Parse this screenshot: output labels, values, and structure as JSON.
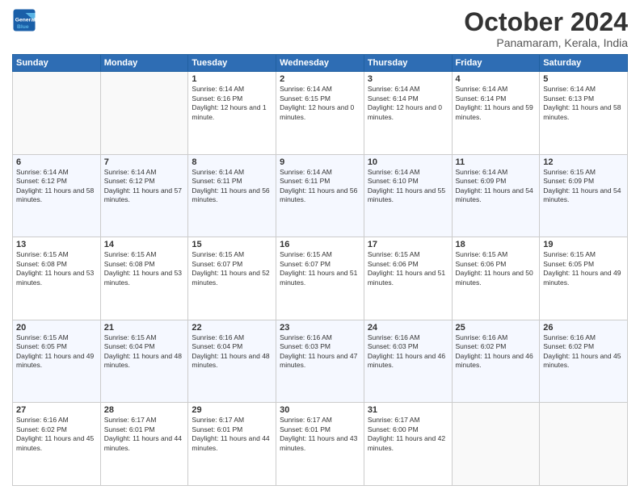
{
  "header": {
    "logo_line1": "General",
    "logo_line2": "Blue",
    "month_title": "October 2024",
    "location": "Panamaram, Kerala, India"
  },
  "days_of_week": [
    "Sunday",
    "Monday",
    "Tuesday",
    "Wednesday",
    "Thursday",
    "Friday",
    "Saturday"
  ],
  "weeks": [
    {
      "days": [
        {
          "num": "",
          "empty": true
        },
        {
          "num": "",
          "empty": true
        },
        {
          "num": "1",
          "sunrise": "6:14 AM",
          "sunset": "6:16 PM",
          "daylight": "12 hours and 1 minute."
        },
        {
          "num": "2",
          "sunrise": "6:14 AM",
          "sunset": "6:15 PM",
          "daylight": "12 hours and 0 minutes."
        },
        {
          "num": "3",
          "sunrise": "6:14 AM",
          "sunset": "6:14 PM",
          "daylight": "12 hours and 0 minutes."
        },
        {
          "num": "4",
          "sunrise": "6:14 AM",
          "sunset": "6:14 PM",
          "daylight": "11 hours and 59 minutes."
        },
        {
          "num": "5",
          "sunrise": "6:14 AM",
          "sunset": "6:13 PM",
          "daylight": "11 hours and 58 minutes."
        }
      ]
    },
    {
      "days": [
        {
          "num": "6",
          "sunrise": "6:14 AM",
          "sunset": "6:12 PM",
          "daylight": "11 hours and 58 minutes."
        },
        {
          "num": "7",
          "sunrise": "6:14 AM",
          "sunset": "6:12 PM",
          "daylight": "11 hours and 57 minutes."
        },
        {
          "num": "8",
          "sunrise": "6:14 AM",
          "sunset": "6:11 PM",
          "daylight": "11 hours and 56 minutes."
        },
        {
          "num": "9",
          "sunrise": "6:14 AM",
          "sunset": "6:11 PM",
          "daylight": "11 hours and 56 minutes."
        },
        {
          "num": "10",
          "sunrise": "6:14 AM",
          "sunset": "6:10 PM",
          "daylight": "11 hours and 55 minutes."
        },
        {
          "num": "11",
          "sunrise": "6:14 AM",
          "sunset": "6:09 PM",
          "daylight": "11 hours and 54 minutes."
        },
        {
          "num": "12",
          "sunrise": "6:15 AM",
          "sunset": "6:09 PM",
          "daylight": "11 hours and 54 minutes."
        }
      ]
    },
    {
      "days": [
        {
          "num": "13",
          "sunrise": "6:15 AM",
          "sunset": "6:08 PM",
          "daylight": "11 hours and 53 minutes."
        },
        {
          "num": "14",
          "sunrise": "6:15 AM",
          "sunset": "6:08 PM",
          "daylight": "11 hours and 53 minutes."
        },
        {
          "num": "15",
          "sunrise": "6:15 AM",
          "sunset": "6:07 PM",
          "daylight": "11 hours and 52 minutes."
        },
        {
          "num": "16",
          "sunrise": "6:15 AM",
          "sunset": "6:07 PM",
          "daylight": "11 hours and 51 minutes."
        },
        {
          "num": "17",
          "sunrise": "6:15 AM",
          "sunset": "6:06 PM",
          "daylight": "11 hours and 51 minutes."
        },
        {
          "num": "18",
          "sunrise": "6:15 AM",
          "sunset": "6:06 PM",
          "daylight": "11 hours and 50 minutes."
        },
        {
          "num": "19",
          "sunrise": "6:15 AM",
          "sunset": "6:05 PM",
          "daylight": "11 hours and 49 minutes."
        }
      ]
    },
    {
      "days": [
        {
          "num": "20",
          "sunrise": "6:15 AM",
          "sunset": "6:05 PM",
          "daylight": "11 hours and 49 minutes."
        },
        {
          "num": "21",
          "sunrise": "6:15 AM",
          "sunset": "6:04 PM",
          "daylight": "11 hours and 48 minutes."
        },
        {
          "num": "22",
          "sunrise": "6:16 AM",
          "sunset": "6:04 PM",
          "daylight": "11 hours and 48 minutes."
        },
        {
          "num": "23",
          "sunrise": "6:16 AM",
          "sunset": "6:03 PM",
          "daylight": "11 hours and 47 minutes."
        },
        {
          "num": "24",
          "sunrise": "6:16 AM",
          "sunset": "6:03 PM",
          "daylight": "11 hours and 46 minutes."
        },
        {
          "num": "25",
          "sunrise": "6:16 AM",
          "sunset": "6:02 PM",
          "daylight": "11 hours and 46 minutes."
        },
        {
          "num": "26",
          "sunrise": "6:16 AM",
          "sunset": "6:02 PM",
          "daylight": "11 hours and 45 minutes."
        }
      ]
    },
    {
      "days": [
        {
          "num": "27",
          "sunrise": "6:16 AM",
          "sunset": "6:02 PM",
          "daylight": "11 hours and 45 minutes."
        },
        {
          "num": "28",
          "sunrise": "6:17 AM",
          "sunset": "6:01 PM",
          "daylight": "11 hours and 44 minutes."
        },
        {
          "num": "29",
          "sunrise": "6:17 AM",
          "sunset": "6:01 PM",
          "daylight": "11 hours and 44 minutes."
        },
        {
          "num": "30",
          "sunrise": "6:17 AM",
          "sunset": "6:01 PM",
          "daylight": "11 hours and 43 minutes."
        },
        {
          "num": "31",
          "sunrise": "6:17 AM",
          "sunset": "6:00 PM",
          "daylight": "11 hours and 42 minutes."
        },
        {
          "num": "",
          "empty": true
        },
        {
          "num": "",
          "empty": true
        }
      ]
    }
  ],
  "labels": {
    "sunrise_prefix": "Sunrise: ",
    "sunset_prefix": "Sunset: ",
    "daylight_prefix": "Daylight: "
  }
}
